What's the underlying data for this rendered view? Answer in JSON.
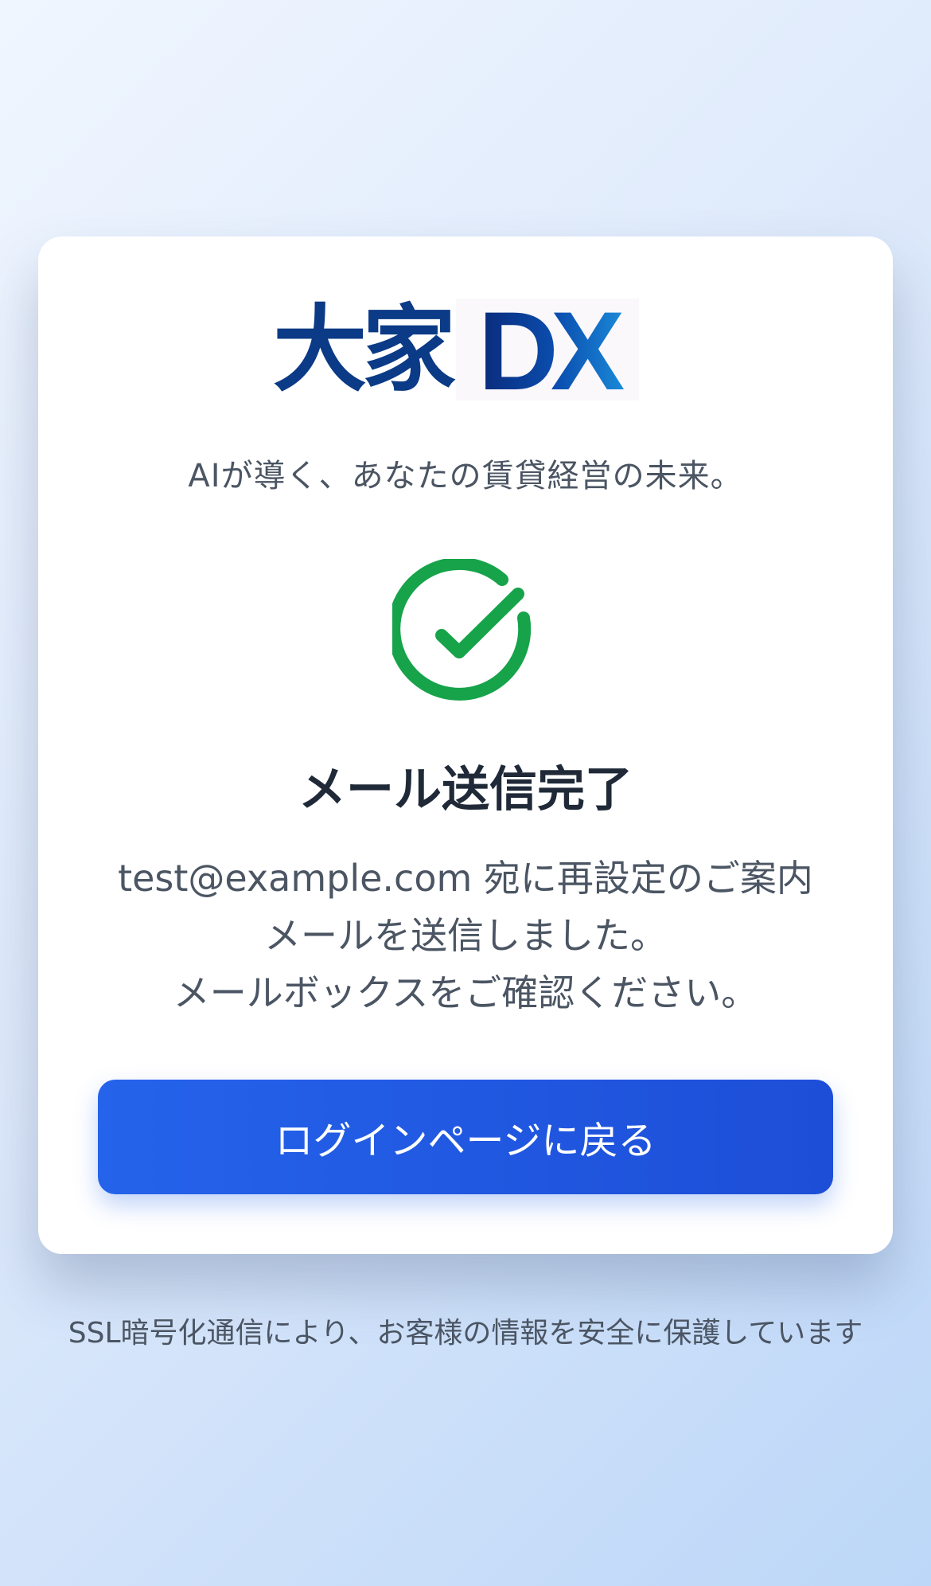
{
  "logo": {
    "kanji": "大家",
    "dx": "DX"
  },
  "tagline": "AIが導く、あなたの賃貸経営の未来。",
  "icon": "check-circle-icon",
  "title": "メール送信完了",
  "message": {
    "line1": "test@example.com 宛に再設定のご案内",
    "line2": "メールを送信しました。",
    "line3": "メールボックスをご確認ください。"
  },
  "button": {
    "label": "ログインページに戻る"
  },
  "footer": "SSL暗号化通信により、お客様の情報を安全に保護しています",
  "colors": {
    "brand_navy": "#0b3a86",
    "success_green": "#16a34a",
    "button_blue": "#2563eb"
  }
}
